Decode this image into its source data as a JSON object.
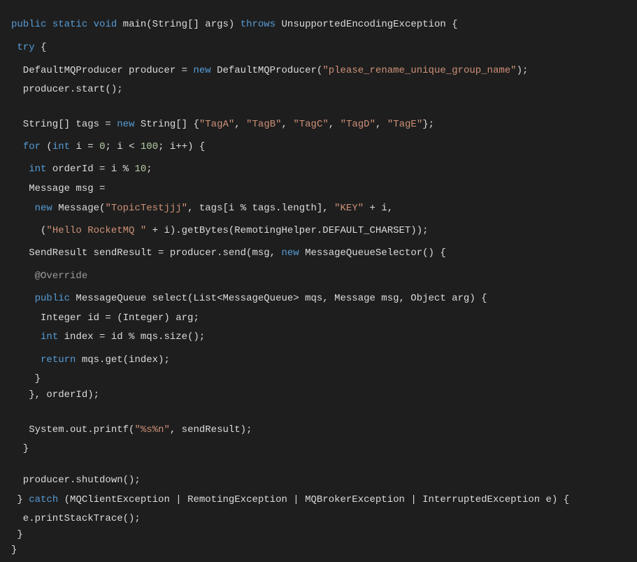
{
  "colors": {
    "background": "#1e1e1e",
    "keyword": "#569cd6",
    "string": "#ce9178",
    "number": "#b5cea8",
    "annotation": "#9b9b9b",
    "plain": "#dcdcdc"
  },
  "code": {
    "lines": [
      [
        [
          "kw",
          "public"
        ],
        [
          "pl",
          " "
        ],
        [
          "kw",
          "static"
        ],
        [
          "pl",
          " "
        ],
        [
          "kw",
          "void"
        ],
        [
          "pl",
          " main(String[] args) "
        ],
        [
          "kw",
          "throws"
        ],
        [
          "pl",
          " UnsupportedEncodingException {"
        ]
      ],
      [
        [
          "pl",
          " "
        ],
        [
          "kw",
          "try"
        ],
        [
          "pl",
          " {"
        ]
      ],
      [
        [
          "pl",
          "  DefaultMQProducer producer = "
        ],
        [
          "kw",
          "new"
        ],
        [
          "pl",
          " DefaultMQProducer("
        ],
        [
          "str",
          "\"please_rename_unique_group_name\""
        ],
        [
          "pl",
          ");"
        ]
      ],
      [
        [
          "pl",
          "  producer.start();"
        ]
      ],
      [
        [
          "pl",
          "  String[] tags = "
        ],
        [
          "kw",
          "new"
        ],
        [
          "pl",
          " String[] {"
        ],
        [
          "str",
          "\"TagA\""
        ],
        [
          "pl",
          ", "
        ],
        [
          "str",
          "\"TagB\""
        ],
        [
          "pl",
          ", "
        ],
        [
          "str",
          "\"TagC\""
        ],
        [
          "pl",
          ", "
        ],
        [
          "str",
          "\"TagD\""
        ],
        [
          "pl",
          ", "
        ],
        [
          "str",
          "\"TagE\""
        ],
        [
          "pl",
          "};"
        ]
      ],
      [
        [
          "pl",
          "  "
        ],
        [
          "kw",
          "for"
        ],
        [
          "pl",
          " ("
        ],
        [
          "kw",
          "int"
        ],
        [
          "pl",
          " i = "
        ],
        [
          "num",
          "0"
        ],
        [
          "pl",
          "; i < "
        ],
        [
          "num",
          "100"
        ],
        [
          "pl",
          "; i++) {"
        ]
      ],
      [
        [
          "pl",
          "   "
        ],
        [
          "kw",
          "int"
        ],
        [
          "pl",
          " orderId = i % "
        ],
        [
          "num",
          "10"
        ],
        [
          "pl",
          ";"
        ]
      ],
      [
        [
          "pl",
          "   Message msg ="
        ]
      ],
      [
        [
          "pl",
          "    "
        ],
        [
          "kw",
          "new"
        ],
        [
          "pl",
          " Message("
        ],
        [
          "str",
          "\"TopicTestjjj\""
        ],
        [
          "pl",
          ", tags[i % tags.length], "
        ],
        [
          "str",
          "\"KEY\""
        ],
        [
          "pl",
          " + i,"
        ]
      ],
      [
        [
          "pl",
          "     ("
        ],
        [
          "str",
          "\"Hello RocketMQ \""
        ],
        [
          "pl",
          " + i).getBytes(RemotingHelper.DEFAULT_CHARSET));"
        ]
      ],
      [
        [
          "pl",
          "   SendResult sendResult = producer.send(msg, "
        ],
        [
          "kw",
          "new"
        ],
        [
          "pl",
          " MessageQueueSelector() {"
        ]
      ],
      [
        [
          "pl",
          "    "
        ],
        [
          "ann",
          "@Override"
        ]
      ],
      [
        [
          "pl",
          "    "
        ],
        [
          "kw",
          "public"
        ],
        [
          "pl",
          " MessageQueue select(List<MessageQueue> mqs, Message msg, Object arg) {"
        ]
      ],
      [
        [
          "pl",
          "     Integer id = (Integer) arg;"
        ]
      ],
      [
        [
          "pl",
          "     "
        ],
        [
          "kw",
          "int"
        ],
        [
          "pl",
          " index = id % mqs.size();"
        ]
      ],
      [
        [
          "pl",
          "     "
        ],
        [
          "kw",
          "return"
        ],
        [
          "pl",
          " mqs.get(index);"
        ]
      ],
      [
        [
          "pl",
          "    }"
        ]
      ],
      [
        [
          "pl",
          "   }, orderId);"
        ]
      ],
      [
        [
          "pl",
          "   System.out.printf("
        ],
        [
          "str",
          "\"%s%n\""
        ],
        [
          "pl",
          ", sendResult);"
        ]
      ],
      [
        [
          "pl",
          "  }"
        ]
      ],
      [
        [
          "pl",
          "  producer.shutdown();"
        ]
      ],
      [
        [
          "pl",
          " } "
        ],
        [
          "kw",
          "catch"
        ],
        [
          "pl",
          " (MQClientException | RemotingException | MQBrokerException | InterruptedException e) {"
        ]
      ],
      [
        [
          "pl",
          "  e.printStackTrace();"
        ]
      ],
      [
        [
          "pl",
          " }"
        ]
      ],
      [
        [
          "pl",
          "}"
        ]
      ]
    ]
  }
}
